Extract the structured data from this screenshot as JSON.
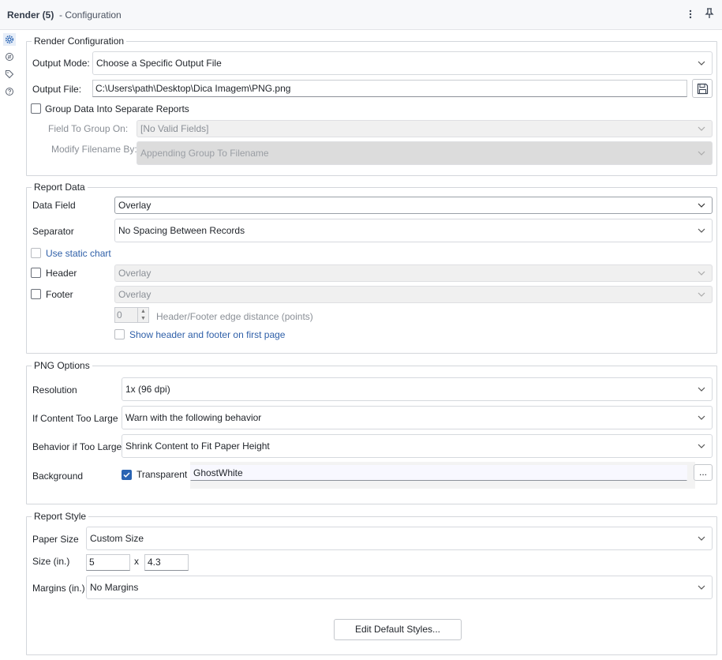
{
  "titlebar": {
    "title": "Render (5)",
    "subtitle": "- Configuration",
    "menu_icon": "more-vertical-icon",
    "pin_icon": "pin-icon"
  },
  "sidebar": {
    "items": [
      {
        "icon": "gear-icon",
        "active": true
      },
      {
        "icon": "connection-icon",
        "active": false
      },
      {
        "icon": "tag-icon",
        "active": false
      },
      {
        "icon": "help-icon",
        "active": false
      }
    ]
  },
  "render_config": {
    "legend": "Render Configuration",
    "output_mode_label": "Output Mode:",
    "output_mode_value": "Choose a Specific Output File",
    "output_file_label": "Output File:",
    "output_file_value": "C:\\Users\\path\\Desktop\\Dica Imagem\\PNG.png",
    "group_data_label": "Group Data Into Separate Reports",
    "field_to_group_label": "Field To Group On:",
    "field_to_group_value": "[No Valid Fields]",
    "modify_filename_label": "Modify Filename By:",
    "modify_filename_value": "Appending Group To Filename"
  },
  "report_data": {
    "legend": "Report Data",
    "data_field_label": "Data Field",
    "data_field_value": "Overlay",
    "separator_label": "Separator",
    "separator_value": "No Spacing Between Records",
    "static_chart_label": "Use static chart",
    "header_label": "Header",
    "header_value": "Overlay",
    "footer_label": "Footer",
    "footer_value": "Overlay",
    "edge_distance_value": "0",
    "edge_distance_label": "Header/Footer edge distance (points)",
    "show_first_page_label": "Show header and footer on first page"
  },
  "png_options": {
    "legend": "PNG Options",
    "resolution_label": "Resolution",
    "resolution_value": "1x (96 dpi)",
    "content_too_large_label": "If Content Too Large",
    "content_too_large_value": "Warn with the following behavior",
    "behavior_label": "Behavior if Too Large",
    "behavior_value": "Shrink Content to Fit Paper Height",
    "background_label": "Background",
    "transparent_label": "Transparent",
    "transparent_checked": true,
    "background_color_value": "GhostWhite",
    "browse_label": "..."
  },
  "report_style": {
    "legend": "Report Style",
    "paper_size_label": "Paper Size",
    "paper_size_value": "Custom Size",
    "size_label": "Size (in.)",
    "width_value": "5",
    "x_label": "x",
    "height_value": "4.3",
    "margins_label": "Margins (in.)",
    "margins_value": "No Margins",
    "edit_styles_label": "Edit Default Styles..."
  },
  "colors": {
    "accent": "#2a64b3",
    "border": "#d3d6db",
    "disabled_text": "#8a8f96"
  }
}
